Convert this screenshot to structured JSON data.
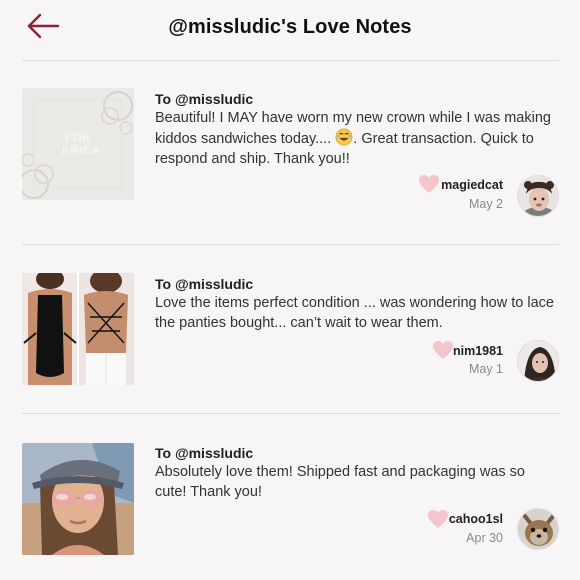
{
  "header": {
    "title": "@missludic's Love Notes",
    "back_icon": "back-arrow-icon"
  },
  "notes": [
    {
      "to": "To @missludic",
      "text_before": "Beautiful! I MAY have worn my new crown while I was making kiddos sandwiches today.... ",
      "text_after": ". Great transaction. Quick to respond and ship. Thank you!!",
      "thumb_text": "FOR ERICA",
      "username": "magiedcat",
      "date": "May 2"
    },
    {
      "to": "To @missludic",
      "text": "Love the items perfect condition ... was wondering how to lace the panties bought... can’t wait to wear them.",
      "username": "nim1981",
      "date": "May 1"
    },
    {
      "to": "To @missludic",
      "text": "Absolutely love them! Shipped fast and packaging was so cute! Thank you!",
      "username": "cahoo1sl",
      "date": "Apr 30"
    }
  ],
  "colors": {
    "accent": "#8c2232",
    "heart": "#f4c6cc",
    "background": "#f7f5f6"
  }
}
